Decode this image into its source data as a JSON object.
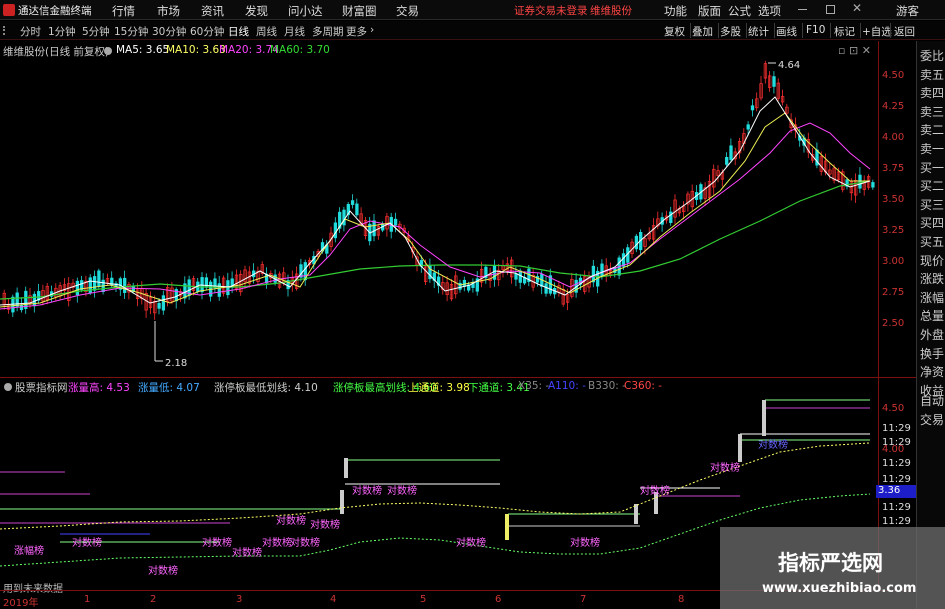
{
  "app": {
    "title": "通达信金融终端",
    "menu": [
      "行情",
      "市场",
      "资讯",
      "发现",
      "问小达",
      "财富圈",
      "交易"
    ],
    "login_status": "证券交易未登录",
    "stock_name_red": "维维股份",
    "right_menu": [
      "功能",
      "版面",
      "公式",
      "选项"
    ],
    "guest": "游客"
  },
  "toolbar": {
    "periods": [
      "分时",
      "1分钟",
      "5分钟",
      "15分钟",
      "30分钟",
      "60分钟",
      "日线",
      "周线",
      "月线",
      "多周期",
      "更多"
    ],
    "active_period": "日线",
    "right_buttons": [
      "复权",
      "叠加",
      "多股",
      "统计",
      "画线",
      "F10",
      "标记",
      "+自选",
      "返回"
    ]
  },
  "main_chart": {
    "header_stock": "维维股份(日线 前复权)",
    "ma": [
      {
        "label": "MA5: 3.65",
        "color": "#ffffff"
      },
      {
        "label": "MA10: 3.63",
        "color": "#ffff66"
      },
      {
        "label": "MA20: 3.74",
        "color": "#ff44ff"
      },
      {
        "label": "MA60: 3.70",
        "color": "#33dd33"
      }
    ],
    "high_label": "4.64",
    "low_label": "2.18",
    "axis_ticks": [
      "4.50",
      "4.25",
      "4.00",
      "3.75",
      "3.50",
      "3.25",
      "3.00",
      "2.75",
      "2.50"
    ]
  },
  "sub_chart": {
    "indicator_name": "股票指标网",
    "items": [
      {
        "label": "涨量高:",
        "value": "4.53",
        "color": "#ff44ff"
      },
      {
        "label": "涨量低:",
        "value": "4.07",
        "color": "#44aaff"
      },
      {
        "label": "涨停板最低划线:",
        "value": "4.10",
        "color": "#cccccc"
      },
      {
        "label": "涨停板最高划线:",
        "value": "4.60",
        "color": "#44ff44"
      },
      {
        "label": "上通道:",
        "value": "3.98",
        "color": "#ffff44"
      },
      {
        "label": "下通道:",
        "value": "3.41",
        "color": "#44ff44"
      },
      {
        "label": "X35:",
        "value": "-",
        "color": "#888888"
      },
      {
        "label": "A110:",
        "value": "-",
        "color": "#4444ff"
      },
      {
        "label": "B330:",
        "value": "-",
        "color": "#888888"
      },
      {
        "label": "C360:",
        "value": "-",
        "color": "#ff4444"
      }
    ],
    "axis_ticks": [
      "4.50",
      "11:29",
      "11:29",
      "4.00",
      "11:29",
      "11:29",
      "11:29",
      "11:29",
      "11:29"
    ],
    "price_tag": "3.36",
    "tags": [
      "涨幅榜",
      "对数榜",
      "对数榜",
      "对数榜",
      "对数榜",
      "对数榜",
      "对数榜",
      "对数榜",
      "对数榜",
      "对数榜",
      "对数榜",
      "对数榜",
      "对数榜",
      "对数榜",
      "对数榜",
      "对数榜"
    ],
    "future_data_note": "用到未来数据"
  },
  "side_panel": {
    "items": [
      "委比",
      "卖五",
      "卖四",
      "卖三",
      "卖二",
      "卖一",
      "买一",
      "买二",
      "买三",
      "买四",
      "买五",
      "现价",
      "涨跌",
      "涨幅",
      "总量",
      "外盘",
      "换手",
      "净资",
      "收益",
      "自动",
      "交易"
    ]
  },
  "bottom_axis": {
    "labels": [
      "2019年",
      "1",
      "2",
      "3",
      "4",
      "5",
      "6",
      "7",
      "8"
    ]
  },
  "watermark": {
    "title": "指标严选网",
    "url": "www.xuezhibiao.com"
  }
}
